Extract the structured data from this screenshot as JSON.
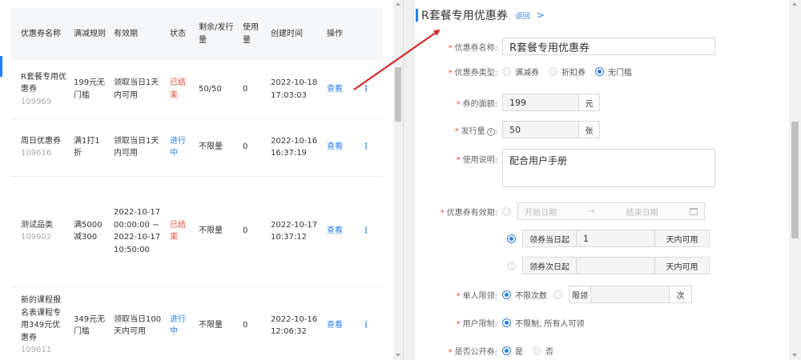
{
  "list": {
    "headers": {
      "name": "优惠券名称",
      "rule": "满减规则",
      "validity": "有效期",
      "status": "状态",
      "remaining": "剩余/发行量",
      "used": "使用量",
      "created": "创建时间",
      "action": "操作"
    },
    "rows": [
      {
        "name": "R套餐专用优惠券",
        "id": "109969",
        "rule": "199元无门槛",
        "validity": "领取当日1天内可用",
        "status": "已结束",
        "remaining": "50/50",
        "used": "0",
        "created": "2022-10-18 17:03:03",
        "action": "查看",
        "more": "⋮"
      },
      {
        "name": "周日优惠券",
        "id": "109616",
        "rule": "满1打1折",
        "validity": "领取当日1天内可用",
        "status": "进行中",
        "remaining": "不限量",
        "used": "0",
        "created": "2022-10-16 16:37:19",
        "action": "查看",
        "more": "⋮"
      },
      {
        "name": "测试品类",
        "id": "109902",
        "rule": "满5000减300",
        "validity": "2022-10-17 00:00:00 ~ 2022-10-17 10:50:00",
        "status": "已结束",
        "remaining": "不限量",
        "used": "0",
        "created": "2022-10-17 10:37:12",
        "action": "查看",
        "more": "⋮"
      },
      {
        "name": "新的课程报名表课程专用349元优惠券",
        "id": "109611",
        "rule": "349元无门槛",
        "validity": "领取当日100天内可用",
        "status": "进行中",
        "remaining": "不限量",
        "used": "0",
        "created": "2022-10-16 12:06:32",
        "action": "查看",
        "more": "⋮"
      }
    ]
  },
  "detail": {
    "title": "R套餐专用优惠券",
    "back": "返回",
    "chevron": ">",
    "fields": {
      "name_label": "优惠券名称:",
      "name_value": "R套餐专用优惠券",
      "type_label": "优惠券类型:",
      "type_options": [
        "满减券",
        "折扣券",
        "无门槛"
      ],
      "amount_label": "券的面额:",
      "amount_value": "199",
      "amount_unit": "元",
      "issue_label": "发行量",
      "issue_help": "?",
      "issue_value": "50",
      "issue_unit": "张",
      "desc_label": "使用说明:",
      "desc_value": "配合用户手册",
      "validity_label": "优惠券有效期:",
      "start_placeholder": "开始日期",
      "range_arrow": "→",
      "end_placeholder": "结束日期",
      "same_day_label": "领券当日起",
      "same_day_value": "1",
      "same_day_unit": "天内可用",
      "next_day_label": "领券次日起",
      "next_day_unit": "天内可用",
      "limit_label": "单人限领:",
      "limit_option": "不限次数",
      "limit_prefix": "限领",
      "limit_unit": "次",
      "user_label": "用户限制:",
      "user_option": "不限制, 所有人可领",
      "public_label": "是否公开券:",
      "public_yes": "是",
      "public_no": "否"
    }
  },
  "colors": {
    "accent": "#2b7de9",
    "ended": "#e44d3a",
    "annotation_arrow": "#d42a2a"
  },
  "icons": {
    "calendar": "calendar-icon",
    "more": "more-vertical-icon",
    "help": "help-circle-icon"
  }
}
